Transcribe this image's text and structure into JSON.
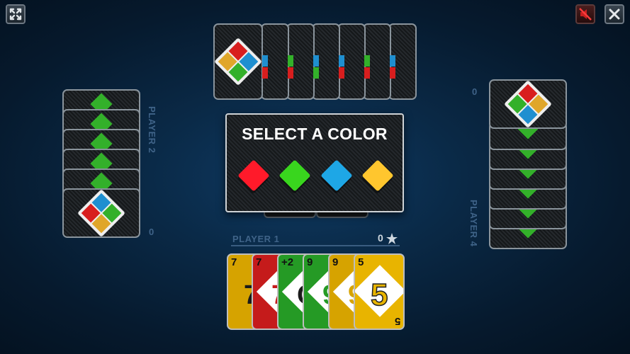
{
  "top_buttons": {
    "fullscreen_icon": "expand-arrows-icon",
    "sound_icon": "muted-speaker-icon",
    "close_icon": "close-x-icon"
  },
  "dialog": {
    "title": "SELECT A COLOR",
    "colors": [
      {
        "name": "red",
        "hex": "#ff1a2a"
      },
      {
        "name": "green",
        "hex": "#39d61e"
      },
      {
        "name": "blue",
        "hex": "#1ea7e6"
      },
      {
        "name": "yellow",
        "hex": "#ffc62e"
      }
    ]
  },
  "players": {
    "player1": {
      "label": "PLAYER 1",
      "score": "0"
    },
    "player2": {
      "label": "PLAYER 2",
      "score": "0"
    },
    "player4": {
      "label": "PLAYER 4",
      "score": "0"
    }
  },
  "hand": [
    {
      "rank": "7",
      "center": "7",
      "color": "#e8b400"
    },
    {
      "rank": "7",
      "center": "7",
      "color": "#cf1a1a"
    },
    {
      "rank": "+2",
      "center": "C",
      "color": "#2aa52a"
    },
    {
      "rank": "9",
      "center": "9",
      "color": "#2aa52a"
    },
    {
      "rank": "9",
      "center": "9",
      "color": "#e8b400"
    },
    {
      "rank": "5",
      "center": "5",
      "color": "#e8b400"
    }
  ],
  "card_colors": {
    "red": "#d81e1e",
    "green": "#33b02a",
    "blue": "#1f8fd0",
    "yellow": "#e0a62a"
  }
}
